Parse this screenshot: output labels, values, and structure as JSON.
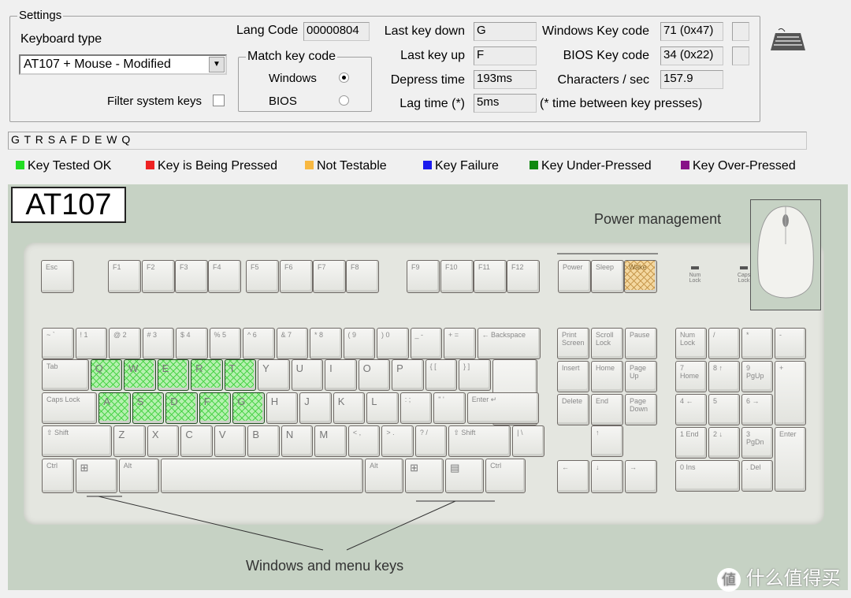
{
  "settings": {
    "title": "Settings",
    "keyboard_type_label": "Keyboard type",
    "keyboard_type_value": "AT107 + Mouse - Modified",
    "filter_label": "Filter system keys",
    "filter_checked": false,
    "lang_code_label": "Lang Code",
    "lang_code_value": "00000804",
    "match": {
      "title": "Match key code",
      "windows": "Windows",
      "bios": "BIOS",
      "selected": "Windows"
    },
    "last_key_down_label": "Last key down",
    "last_key_down": "G",
    "last_key_up_label": "Last key up",
    "last_key_up": "F",
    "depress_label": "Depress time",
    "depress": "193ms",
    "lag_label": "Lag time (*)",
    "lag": "5ms",
    "lag_note": "(* time between key presses)",
    "win_code_label": "Windows Key code",
    "win_code": "71 (0x47)",
    "bios_code_label": "BIOS Key code",
    "bios_code": "34 (0x22)",
    "cps_label": "Characters / sec",
    "cps": "157.9"
  },
  "history": "G T R S A F D E W Q",
  "legend": [
    {
      "label": "Key Tested OK",
      "color": "#22dd22"
    },
    {
      "label": "Key is Being Pressed",
      "color": "#ee2222"
    },
    {
      "label": "Not Testable",
      "color": "#f8b840"
    },
    {
      "label": "Key Failure",
      "color": "#1a1aee"
    },
    {
      "label": "Key Under-Pressed",
      "color": "#118811"
    },
    {
      "label": "Key Over-Pressed",
      "color": "#881188"
    }
  ],
  "keyboard": {
    "model": "AT107",
    "power_label": "Power management",
    "windows_menu_label": "Windows and menu keys",
    "fn_row": [
      "Esc",
      "F1",
      "F2",
      "F3",
      "F4",
      "F5",
      "F6",
      "F7",
      "F8",
      "F9",
      "F10",
      "F11",
      "F12",
      "Power",
      "Sleep",
      "Wake"
    ],
    "fn_status": [
      "",
      "",
      "",
      "",
      "",
      "",
      "",
      "",
      "",
      "",
      "",
      "",
      "",
      "",
      "",
      "nt"
    ],
    "rows": [
      [
        "~ `",
        "! 1",
        "@ 2",
        "# 3",
        "$ 4",
        "% 5",
        "^ 6",
        "& 7",
        "* 8",
        "( 9",
        ") 0",
        "_ -",
        "+ =",
        "← Backspace"
      ],
      [
        "Tab",
        "Q",
        "W",
        "E",
        "R",
        "T",
        "Y",
        "U",
        "I",
        "O",
        "P",
        "{ [",
        "} ]",
        ""
      ],
      [
        "Caps Lock",
        "A",
        "S",
        "D",
        "F",
        "G",
        "H",
        "J",
        "K",
        "L",
        ": ;",
        "\" '",
        "Enter ↵"
      ],
      [
        "⇧ Shift",
        "Z",
        "X",
        "C",
        "V",
        "B",
        "N",
        "M",
        "< ,",
        "> .",
        "? /",
        "⇧ Shift",
        "| \\"
      ],
      [
        "Ctrl",
        "⊞",
        "Alt",
        "",
        "Alt",
        "⊞",
        "▤",
        "Ctrl"
      ]
    ],
    "tested": [
      "Q",
      "W",
      "E",
      "R",
      "T",
      "A",
      "S",
      "D",
      "F",
      "G"
    ],
    "nav": [
      "Print Screen",
      "Scroll Lock",
      "Pause",
      "Insert",
      "Home",
      "Page Up",
      "Delete",
      "End",
      "Page Down",
      "↑",
      "←",
      "↓",
      "→"
    ],
    "numpad": [
      "Num Lock",
      "/",
      "*",
      "-",
      "7 Home",
      "8 ↑",
      "9 PgUp",
      "+",
      "4 ←",
      "5",
      "6 →",
      "1 End",
      "2 ↓",
      "3 PgDn",
      "Enter",
      "0 Ins",
      ". Del"
    ],
    "locks": [
      "Num Lock",
      "Caps Lock"
    ]
  },
  "watermark": "什么值得买"
}
